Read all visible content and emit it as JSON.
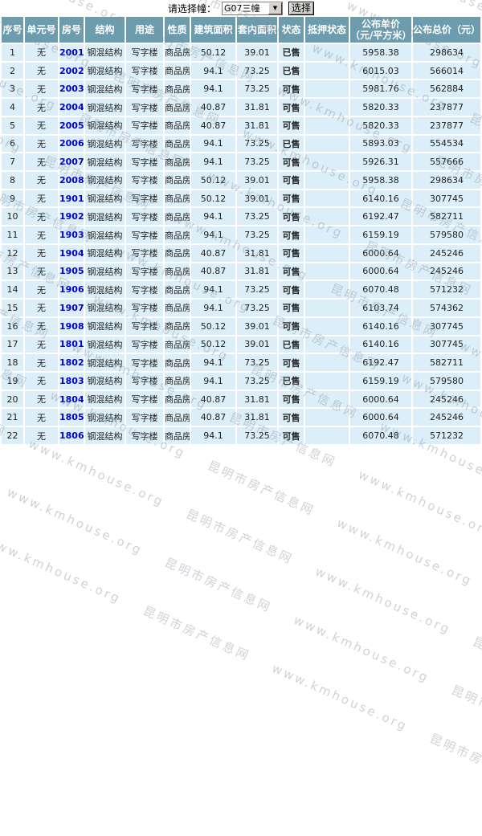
{
  "controls": {
    "select_label": "请选择幢：",
    "building_select_value": "G07三幢",
    "select_button_label": "选择"
  },
  "watermark": {
    "text": "昆明市房产信息网 www.kmhouse.org"
  },
  "colors": {
    "header_bg": "#6d9cae",
    "row_bg": "#dceff8",
    "sold": "#dd0000",
    "available": "#008800",
    "link": "#0000cc"
  },
  "table": {
    "columns": [
      {
        "key": "seq",
        "label": "序号"
      },
      {
        "key": "unit_no",
        "label": "单元号"
      },
      {
        "key": "room_no",
        "label": "房号"
      },
      {
        "key": "structure",
        "label": "结构"
      },
      {
        "key": "usage",
        "label": "用途"
      },
      {
        "key": "nature",
        "label": "性质"
      },
      {
        "key": "build_area",
        "label": "建筑面积"
      },
      {
        "key": "inner_area",
        "label": "套内面积"
      },
      {
        "key": "status",
        "label": "状态"
      },
      {
        "key": "mortgage_status",
        "label": "抵押状态"
      },
      {
        "key": "unit_price",
        "label": "公布单价（元/平方米）"
      },
      {
        "key": "total_price",
        "label": "公布总价（元）"
      }
    ],
    "rows": [
      {
        "seq": "1",
        "unit_no": "无",
        "room_no": "2001",
        "structure": "钢混结构",
        "usage": "写字楼",
        "nature": "商品房",
        "build_area": "50.12",
        "inner_area": "39.01",
        "status": "已售",
        "status_type": "sold",
        "mortgage_status": "",
        "unit_price": "5958.38",
        "total_price": "298634"
      },
      {
        "seq": "2",
        "unit_no": "无",
        "room_no": "2002",
        "structure": "钢混结构",
        "usage": "写字楼",
        "nature": "商品房",
        "build_area": "94.1",
        "inner_area": "73.25",
        "status": "已售",
        "status_type": "sold",
        "mortgage_status": "",
        "unit_price": "6015.03",
        "total_price": "566014"
      },
      {
        "seq": "3",
        "unit_no": "无",
        "room_no": "2003",
        "structure": "钢混结构",
        "usage": "写字楼",
        "nature": "商品房",
        "build_area": "94.1",
        "inner_area": "73.25",
        "status": "可售",
        "status_type": "available",
        "mortgage_status": "",
        "unit_price": "5981.76",
        "total_price": "562884"
      },
      {
        "seq": "4",
        "unit_no": "无",
        "room_no": "2004",
        "structure": "钢混结构",
        "usage": "写字楼",
        "nature": "商品房",
        "build_area": "40.87",
        "inner_area": "31.81",
        "status": "可售",
        "status_type": "available",
        "mortgage_status": "",
        "unit_price": "5820.33",
        "total_price": "237877"
      },
      {
        "seq": "5",
        "unit_no": "无",
        "room_no": "2005",
        "structure": "钢混结构",
        "usage": "写字楼",
        "nature": "商品房",
        "build_area": "40.87",
        "inner_area": "31.81",
        "status": "可售",
        "status_type": "available",
        "mortgage_status": "",
        "unit_price": "5820.33",
        "total_price": "237877"
      },
      {
        "seq": "6",
        "unit_no": "无",
        "room_no": "2006",
        "structure": "钢混结构",
        "usage": "写字楼",
        "nature": "商品房",
        "build_area": "94.1",
        "inner_area": "73.25",
        "status": "已售",
        "status_type": "sold",
        "mortgage_status": "",
        "unit_price": "5893.03",
        "total_price": "554534"
      },
      {
        "seq": "7",
        "unit_no": "无",
        "room_no": "2007",
        "structure": "钢混结构",
        "usage": "写字楼",
        "nature": "商品房",
        "build_area": "94.1",
        "inner_area": "73.25",
        "status": "可售",
        "status_type": "available",
        "mortgage_status": "",
        "unit_price": "5926.31",
        "total_price": "557666"
      },
      {
        "seq": "8",
        "unit_no": "无",
        "room_no": "2008",
        "structure": "钢混结构",
        "usage": "写字楼",
        "nature": "商品房",
        "build_area": "50.12",
        "inner_area": "39.01",
        "status": "可售",
        "status_type": "available",
        "mortgage_status": "",
        "unit_price": "5958.38",
        "total_price": "298634"
      },
      {
        "seq": "9",
        "unit_no": "无",
        "room_no": "1901",
        "structure": "钢混结构",
        "usage": "写字楼",
        "nature": "商品房",
        "build_area": "50.12",
        "inner_area": "39.01",
        "status": "可售",
        "status_type": "available",
        "mortgage_status": "",
        "unit_price": "6140.16",
        "total_price": "307745"
      },
      {
        "seq": "10",
        "unit_no": "无",
        "room_no": "1902",
        "structure": "钢混结构",
        "usage": "写字楼",
        "nature": "商品房",
        "build_area": "94.1",
        "inner_area": "73.25",
        "status": "可售",
        "status_type": "available",
        "mortgage_status": "",
        "unit_price": "6192.47",
        "total_price": "582711"
      },
      {
        "seq": "11",
        "unit_no": "无",
        "room_no": "1903",
        "structure": "钢混结构",
        "usage": "写字楼",
        "nature": "商品房",
        "build_area": "94.1",
        "inner_area": "73.25",
        "status": "可售",
        "status_type": "available",
        "mortgage_status": "",
        "unit_price": "6159.19",
        "total_price": "579580"
      },
      {
        "seq": "12",
        "unit_no": "无",
        "room_no": "1904",
        "structure": "钢混结构",
        "usage": "写字楼",
        "nature": "商品房",
        "build_area": "40.87",
        "inner_area": "31.81",
        "status": "可售",
        "status_type": "available",
        "mortgage_status": "",
        "unit_price": "6000.64",
        "total_price": "245246"
      },
      {
        "seq": "13",
        "unit_no": "无",
        "room_no": "1905",
        "structure": "钢混结构",
        "usage": "写字楼",
        "nature": "商品房",
        "build_area": "40.87",
        "inner_area": "31.81",
        "status": "可售",
        "status_type": "available",
        "mortgage_status": "",
        "unit_price": "6000.64",
        "total_price": "245246"
      },
      {
        "seq": "14",
        "unit_no": "无",
        "room_no": "1906",
        "structure": "钢混结构",
        "usage": "写字楼",
        "nature": "商品房",
        "build_area": "94.1",
        "inner_area": "73.25",
        "status": "可售",
        "status_type": "available",
        "mortgage_status": "",
        "unit_price": "6070.48",
        "total_price": "571232"
      },
      {
        "seq": "15",
        "unit_no": "无",
        "room_no": "1907",
        "structure": "钢混结构",
        "usage": "写字楼",
        "nature": "商品房",
        "build_area": "94.1",
        "inner_area": "73.25",
        "status": "可售",
        "status_type": "available",
        "mortgage_status": "",
        "unit_price": "6103.74",
        "total_price": "574362"
      },
      {
        "seq": "16",
        "unit_no": "无",
        "room_no": "1908",
        "structure": "钢混结构",
        "usage": "写字楼",
        "nature": "商品房",
        "build_area": "50.12",
        "inner_area": "39.01",
        "status": "可售",
        "status_type": "available",
        "mortgage_status": "",
        "unit_price": "6140.16",
        "total_price": "307745"
      },
      {
        "seq": "17",
        "unit_no": "无",
        "room_no": "1801",
        "structure": "钢混结构",
        "usage": "写字楼",
        "nature": "商品房",
        "build_area": "50.12",
        "inner_area": "39.01",
        "status": "已售",
        "status_type": "sold",
        "mortgage_status": "",
        "unit_price": "6140.16",
        "total_price": "307745"
      },
      {
        "seq": "18",
        "unit_no": "无",
        "room_no": "1802",
        "structure": "钢混结构",
        "usage": "写字楼",
        "nature": "商品房",
        "build_area": "94.1",
        "inner_area": "73.25",
        "status": "可售",
        "status_type": "available",
        "mortgage_status": "",
        "unit_price": "6192.47",
        "total_price": "582711"
      },
      {
        "seq": "19",
        "unit_no": "无",
        "room_no": "1803",
        "structure": "钢混结构",
        "usage": "写字楼",
        "nature": "商品房",
        "build_area": "94.1",
        "inner_area": "73.25",
        "status": "已售",
        "status_type": "sold",
        "mortgage_status": "",
        "unit_price": "6159.19",
        "total_price": "579580"
      },
      {
        "seq": "20",
        "unit_no": "无",
        "room_no": "1804",
        "structure": "钢混结构",
        "usage": "写字楼",
        "nature": "商品房",
        "build_area": "40.87",
        "inner_area": "31.81",
        "status": "可售",
        "status_type": "available",
        "mortgage_status": "",
        "unit_price": "6000.64",
        "total_price": "245246"
      },
      {
        "seq": "21",
        "unit_no": "无",
        "room_no": "1805",
        "structure": "钢混结构",
        "usage": "写字楼",
        "nature": "商品房",
        "build_area": "40.87",
        "inner_area": "31.81",
        "status": "可售",
        "status_type": "available",
        "mortgage_status": "",
        "unit_price": "6000.64",
        "total_price": "245246"
      },
      {
        "seq": "22",
        "unit_no": "无",
        "room_no": "1806",
        "structure": "钢混结构",
        "usage": "写字楼",
        "nature": "商品房",
        "build_area": "94.1",
        "inner_area": "73.25",
        "status": "可售",
        "status_type": "available",
        "mortgage_status": "",
        "unit_price": "6070.48",
        "total_price": "571232"
      }
    ]
  }
}
